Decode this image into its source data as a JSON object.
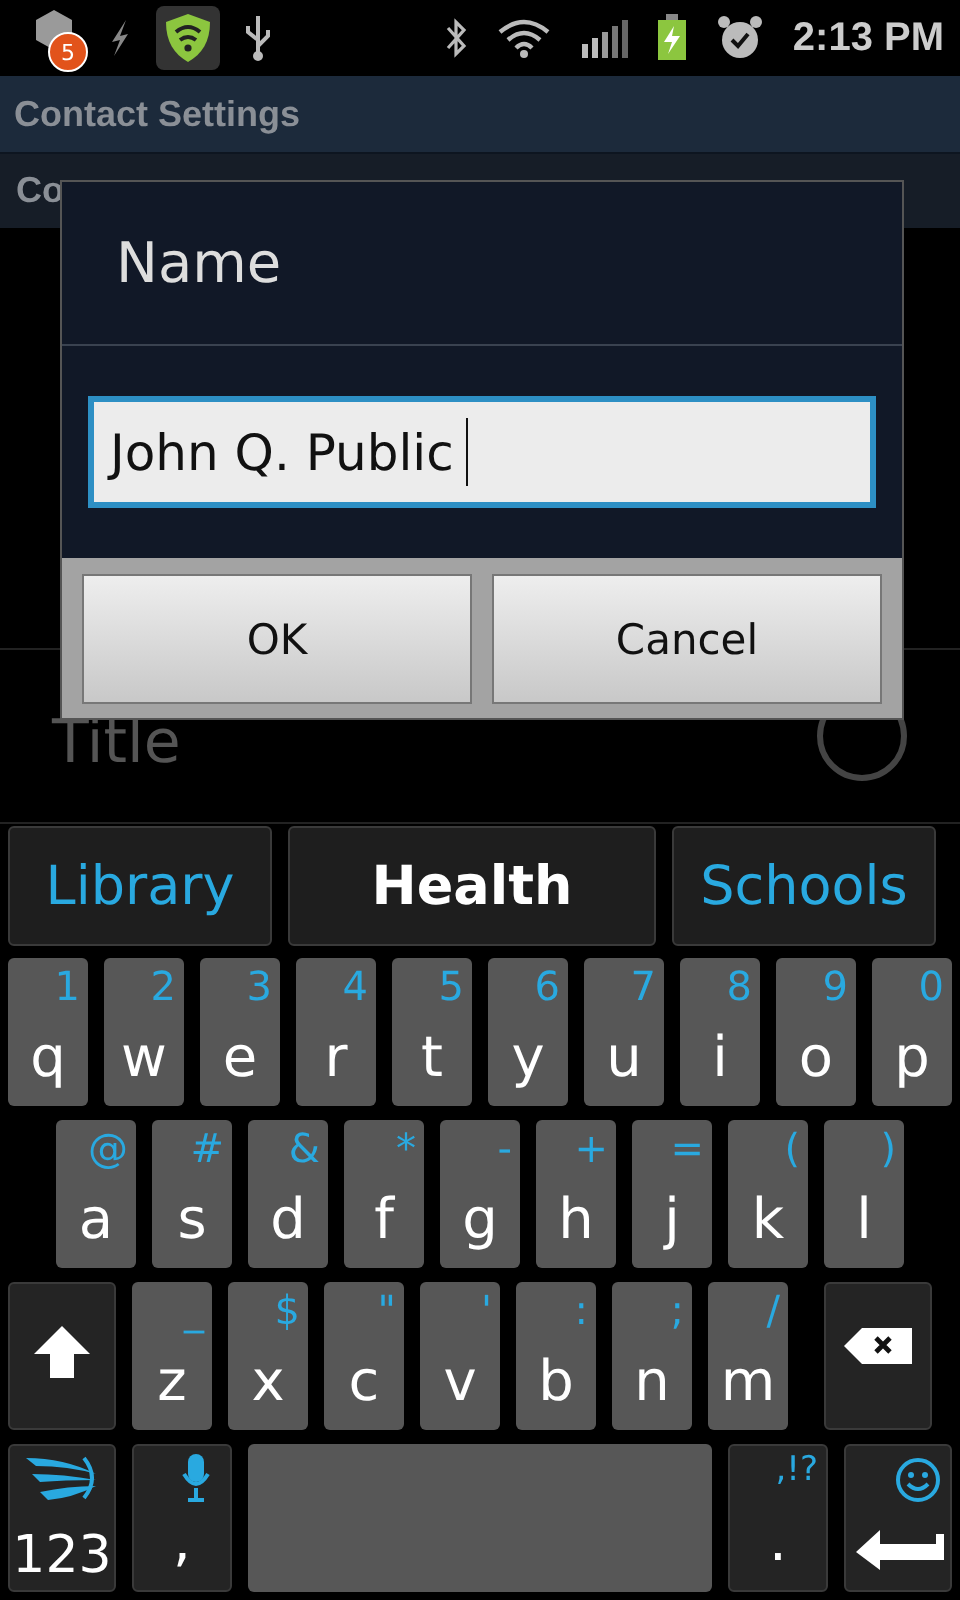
{
  "status_bar": {
    "notification_count": "5",
    "time": "2:13 PM"
  },
  "header": {
    "title": "Contact Settings",
    "subtitle": "Co"
  },
  "background_row": {
    "label": "Title"
  },
  "dialog": {
    "title": "Name",
    "field": {
      "value": "John Q. Public"
    },
    "buttons": [
      "OK",
      "Cancel"
    ]
  },
  "keyboard": {
    "suggestions": [
      {
        "text": "Library",
        "selected": false
      },
      {
        "text": "Health",
        "selected": true
      },
      {
        "text": "Schools",
        "selected": false
      }
    ],
    "rows": [
      [
        {
          "kind": "letter",
          "label": "q",
          "alt": "1"
        },
        {
          "kind": "letter",
          "label": "w",
          "alt": "2"
        },
        {
          "kind": "letter",
          "label": "e",
          "alt": "3"
        },
        {
          "kind": "letter",
          "label": "r",
          "alt": "4"
        },
        {
          "kind": "letter",
          "label": "t",
          "alt": "5"
        },
        {
          "kind": "letter",
          "label": "y",
          "alt": "6"
        },
        {
          "kind": "letter",
          "label": "u",
          "alt": "7"
        },
        {
          "kind": "letter",
          "label": "i",
          "alt": "8"
        },
        {
          "kind": "letter",
          "label": "o",
          "alt": "9"
        },
        {
          "kind": "letter",
          "label": "p",
          "alt": "0"
        }
      ],
      [
        {
          "kind": "letter",
          "label": "a",
          "alt": "@"
        },
        {
          "kind": "letter",
          "label": "s",
          "alt": "#"
        },
        {
          "kind": "letter",
          "label": "d",
          "alt": "&"
        },
        {
          "kind": "letter",
          "label": "f",
          "alt": "*"
        },
        {
          "kind": "letter",
          "label": "g",
          "alt": "-"
        },
        {
          "kind": "letter",
          "label": "h",
          "alt": "+"
        },
        {
          "kind": "letter",
          "label": "j",
          "alt": "="
        },
        {
          "kind": "letter",
          "label": "k",
          "alt": "("
        },
        {
          "kind": "letter",
          "label": "l",
          "alt": ")"
        }
      ],
      [
        {
          "kind": "shift"
        },
        {
          "kind": "letter",
          "label": "z",
          "alt": "_"
        },
        {
          "kind": "letter",
          "label": "x",
          "alt": "$"
        },
        {
          "kind": "letter",
          "label": "c",
          "alt": "\""
        },
        {
          "kind": "letter",
          "label": "v",
          "alt": "'"
        },
        {
          "kind": "letter",
          "label": "b",
          "alt": ":"
        },
        {
          "kind": "letter",
          "label": "n",
          "alt": ";"
        },
        {
          "kind": "letter",
          "label": "m",
          "alt": "/"
        },
        {
          "kind": "backspace"
        }
      ],
      [
        {
          "kind": "symbols",
          "label": "123"
        },
        {
          "kind": "comma",
          "label": ","
        },
        {
          "kind": "space"
        },
        {
          "kind": "period",
          "label": ".",
          "alt": ",!?"
        },
        {
          "kind": "enter"
        }
      ]
    ]
  }
}
